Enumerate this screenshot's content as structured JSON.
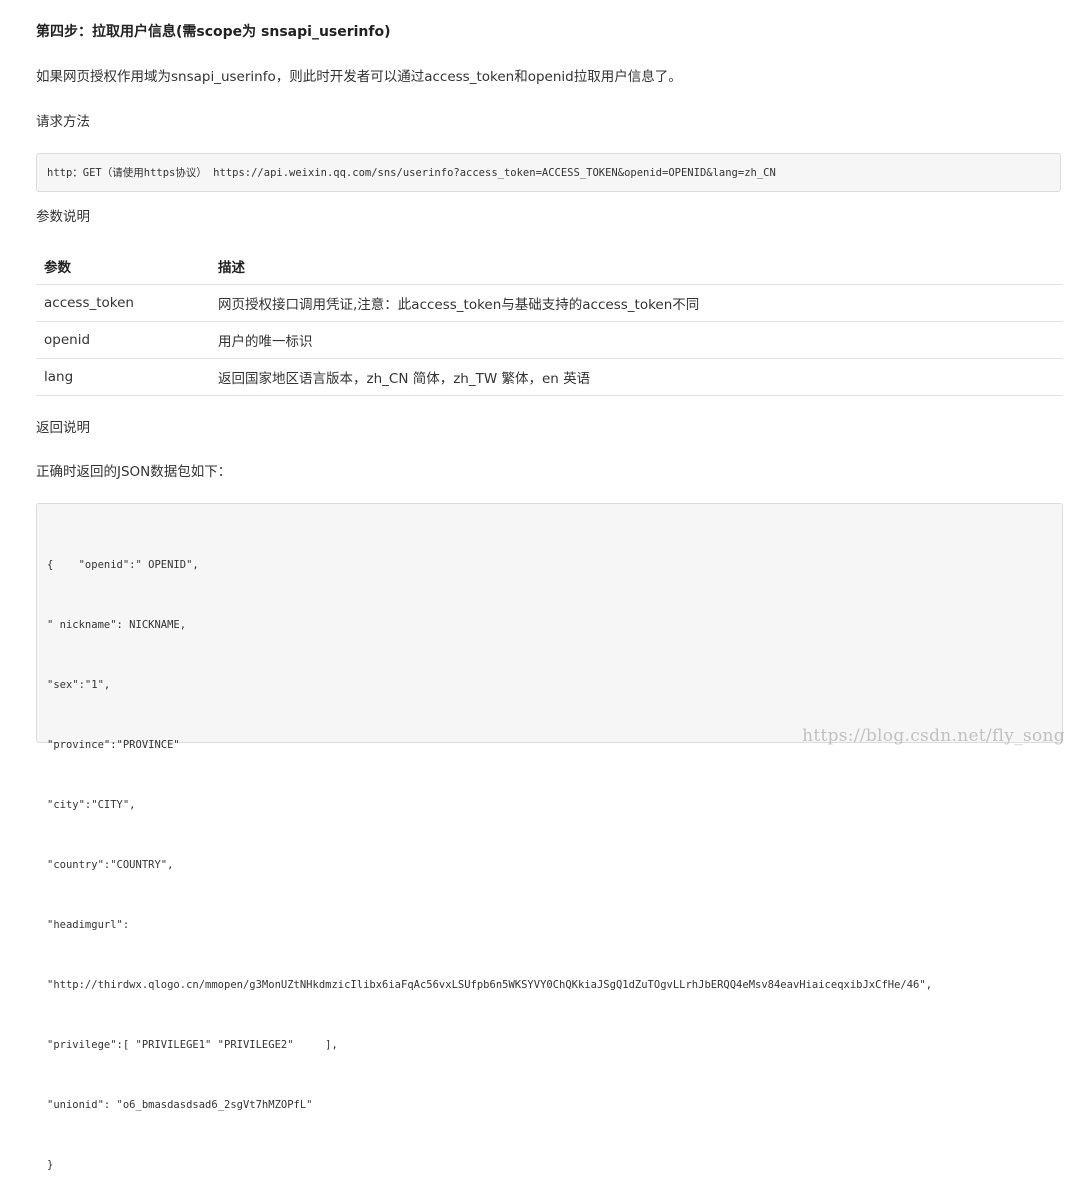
{
  "heading": "第四步：拉取用户信息(需scope为 snsapi_userinfo)",
  "intro": "如果网页授权作用域为snsapi_userinfo，则此时开发者可以通过access_token和openid拉取用户信息了。",
  "request_method_label": "请求方法",
  "request_code": "http：GET（请使用https协议） https://api.weixin.qq.com/sns/userinfo?access_token=ACCESS_TOKEN&openid=OPENID&lang=zh_CN",
  "params_label": "参数说明",
  "params_table": {
    "headers": [
      "参数",
      "描述"
    ],
    "rows": [
      [
        "access_token",
        "网页授权接口调用凭证,注意：此access_token与基础支持的access_token不同"
      ],
      [
        "openid",
        "用户的唯一标识"
      ],
      [
        "lang",
        "返回国家地区语言版本，zh_CN 简体，zh_TW 繁体，en 英语"
      ]
    ]
  },
  "return_label": "返回说明",
  "return_desc": "正确时返回的JSON数据包如下：",
  "json_lines": [
    "{    \"openid\":\" OPENID\",",
    "\" nickname\": NICKNAME,",
    "\"sex\":\"1\",",
    "\"province\":\"PROVINCE\"",
    "\"city\":\"CITY\",",
    "\"country\":\"COUNTRY\",",
    "\"headimgurl\":",
    "\"http://thirdwx.qlogo.cn/mmopen/g3MonUZtNHkdmzicIlibx6iaFqAc56vxLSUfpb6n5WKSYVY0ChQKkiaJSgQ1dZuTOgvLLrhJbERQQ4eMsv84eavHiaiceqxibJxCfHe/46\",",
    "\"privilege\":[ \"PRIVILEGE1\" \"PRIVILEGE2\"     ],",
    "\"unionid\": \"o6_bmasdasdsad6_2sgVt7hMZOPfL\"",
    "}"
  ],
  "watermark": "https://blog.csdn.net/fly_song"
}
